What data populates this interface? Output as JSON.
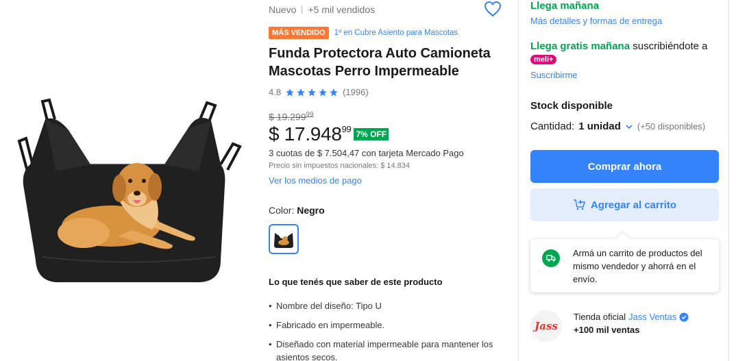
{
  "product": {
    "condition": "Nuevo",
    "sold": "+5 mil vendidos",
    "badge": "MÁS VENDIDO",
    "badge_detail": "1º en Cubre Asiento para Mascotas",
    "title": "Funda Protectora Auto Camioneta Mascotas Perro Impermeable",
    "rating": "4.8",
    "stars": 5,
    "reviews": "(1996)",
    "image_icon": "dog-seat-cover-image"
  },
  "price": {
    "old_integer": "$ 19.299",
    "old_cents": "99",
    "integer": "$ 17.948",
    "cents": "99",
    "discount": "7% OFF",
    "installments": "3 cuotas de $ 7.504,47 con tarjeta Mercado Pago",
    "tax_note": "Precio sin impuestos nacionales: $ 14.834",
    "payment_link": "Ver los medios de pago"
  },
  "variation": {
    "label": "Color: ",
    "value": "Negro"
  },
  "features": {
    "title": "Lo que tenés que saber de este producto",
    "items": [
      "Nombre del diseño: Tipo U",
      "Fabricado en impermeable.",
      "Diseñado con material impermeable para mantener los asientos secos."
    ]
  },
  "shipping": {
    "title": "Llega mañana",
    "details_link": "Más detalles y formas de entrega",
    "free_green": "Llega gratis mañana",
    "free_rest": " suscribiéndote a",
    "meli_badge": "meli+",
    "subscribe_link": "Suscribirme"
  },
  "stock": {
    "title": "Stock disponible",
    "qty_label": "Cantidad: ",
    "qty_value": "1 unidad",
    "available": "(+50 disponibles)"
  },
  "actions": {
    "buy": "Comprar ahora",
    "cart": "Agregar al carrito"
  },
  "tooltip": {
    "text": "Armá un carrito de productos del mismo vendedor y ahorrá en el envío."
  },
  "seller": {
    "prefix": "Tienda oficial",
    "name": "Jass Ventas",
    "sales": "+100 mil ventas",
    "logo_text": "Jass"
  },
  "colors": {
    "accent": "#3483fa",
    "green": "#00a650",
    "orange": "#ff7733",
    "pink": "#e4097a"
  }
}
